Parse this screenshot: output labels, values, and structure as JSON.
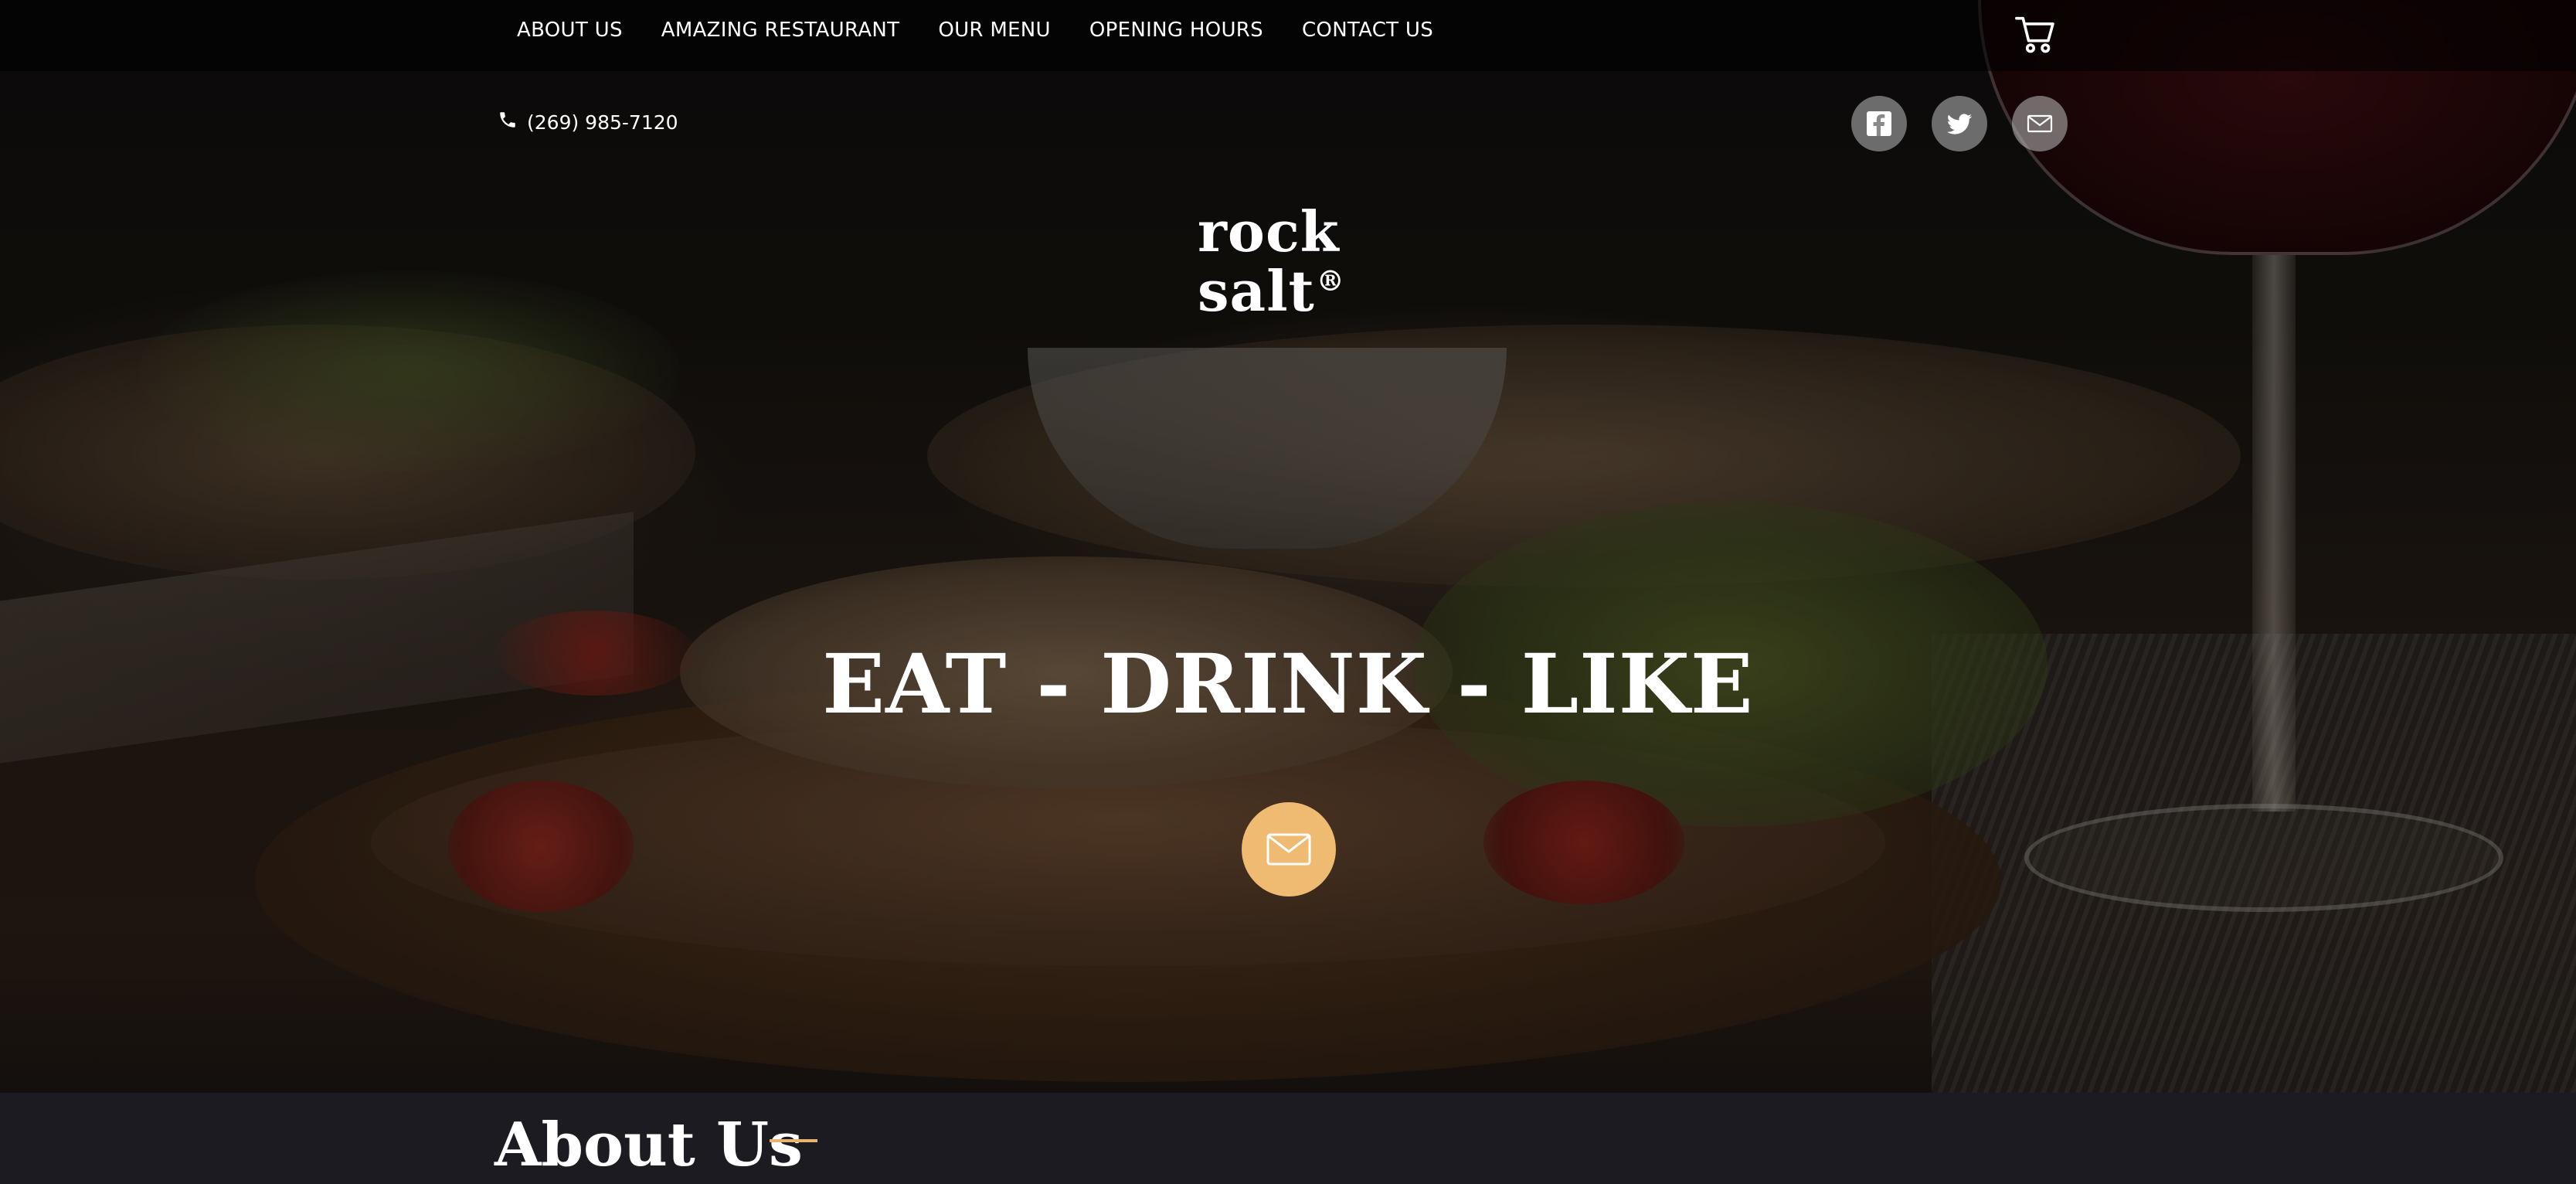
{
  "nav": {
    "items": [
      {
        "label": "ABOUT US"
      },
      {
        "label": "AMAZING RESTAURANT"
      },
      {
        "label": "OUR MENU"
      },
      {
        "label": "OPENING HOURS"
      },
      {
        "label": "CONTACT US"
      }
    ],
    "cart_icon": "cart-icon"
  },
  "contact": {
    "phone": "(269) 985-7120",
    "phone_icon": "phone-icon"
  },
  "socials": [
    {
      "icon": "facebook-icon"
    },
    {
      "icon": "twitter-icon"
    },
    {
      "icon": "mail-icon"
    }
  ],
  "logo": {
    "line1": "rock",
    "line2": "salt",
    "mark": "®"
  },
  "hero": {
    "headline": "EAT - DRINK - LIKE",
    "cta_icon": "mail-icon"
  },
  "about": {
    "title": "About Us"
  },
  "colors": {
    "accent": "#efba72",
    "strip": "#1c1b22",
    "text": "#ffffff"
  }
}
